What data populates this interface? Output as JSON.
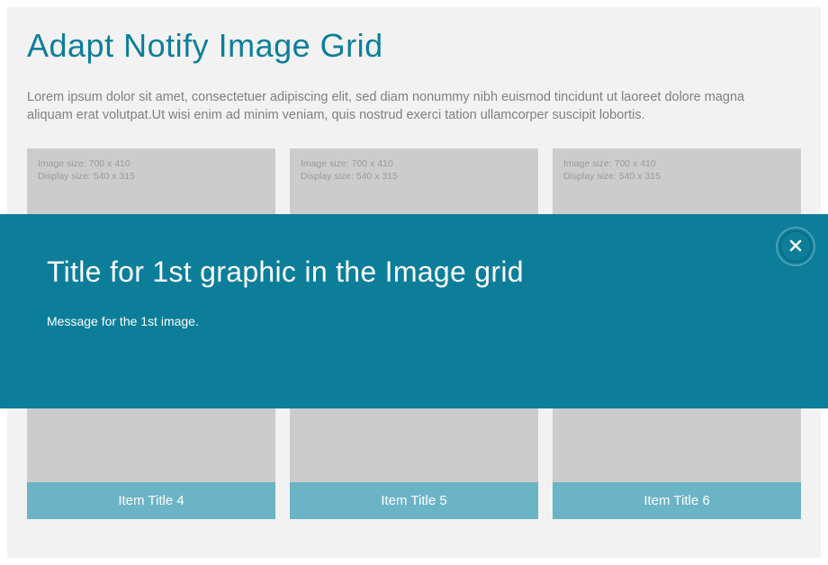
{
  "colors": {
    "accent": "#0c7e9a",
    "caption_bg": "#6bb4c6",
    "panel_bg": "#f2f2f2",
    "placeholder_bg": "#cccccc"
  },
  "page": {
    "title": "Adapt Notify Image Grid",
    "intro": "Lorem ipsum dolor sit amet, consectetuer adipiscing elit, sed diam nonummy nibh euismod tincidunt ut laoreet dolore magna aliquam erat volutpat.Ut wisi enim ad minim veniam, quis nostrud exerci tation ullamcorper suscipit lobortis."
  },
  "placeholder": {
    "image_size_line": "Image size: 700 x 410",
    "display_size_line": "Display size: 540 x 315"
  },
  "grid": {
    "items": [
      {
        "title": "Item Title 4"
      },
      {
        "title": "Item Title 5"
      },
      {
        "title": "Item Title 6"
      }
    ]
  },
  "notify": {
    "title": "Title for 1st graphic in the Image grid",
    "message": "Message for the 1st image.",
    "close_label": "Close"
  }
}
